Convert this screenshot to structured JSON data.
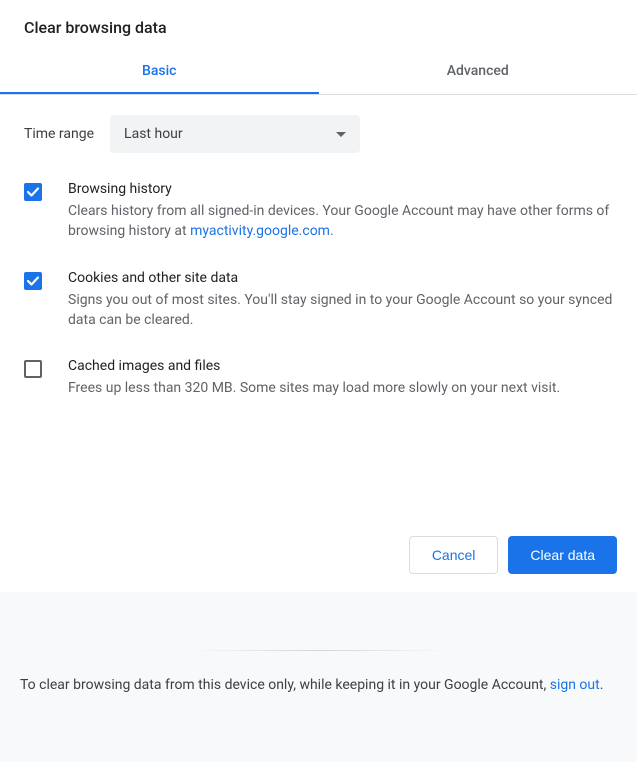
{
  "title": "Clear browsing data",
  "tabs": {
    "basic": "Basic",
    "advanced": "Advanced",
    "active": "basic"
  },
  "time": {
    "label": "Time range",
    "selected": "Last hour"
  },
  "items": [
    {
      "checked": true,
      "title": "Browsing history",
      "desc_pre": "Clears history from all signed-in devices. Your Google Account may have other forms of browsing history at ",
      "link_text": "myactivity.google.com",
      "desc_post": "."
    },
    {
      "checked": true,
      "title": "Cookies and other site data",
      "desc_pre": "Signs you out of most sites. You'll stay signed in to your Google Account so your synced data can be cleared.",
      "link_text": "",
      "desc_post": ""
    },
    {
      "checked": false,
      "title": "Cached images and files",
      "desc_pre": "Frees up less than 320 MB. Some sites may load more slowly on your next visit.",
      "link_text": "",
      "desc_post": ""
    }
  ],
  "buttons": {
    "cancel": "Cancel",
    "confirm": "Clear data"
  },
  "footer": {
    "pre": "To clear browsing data from this device only, while keeping it in your Google Account, ",
    "link": "sign out",
    "post": "."
  }
}
